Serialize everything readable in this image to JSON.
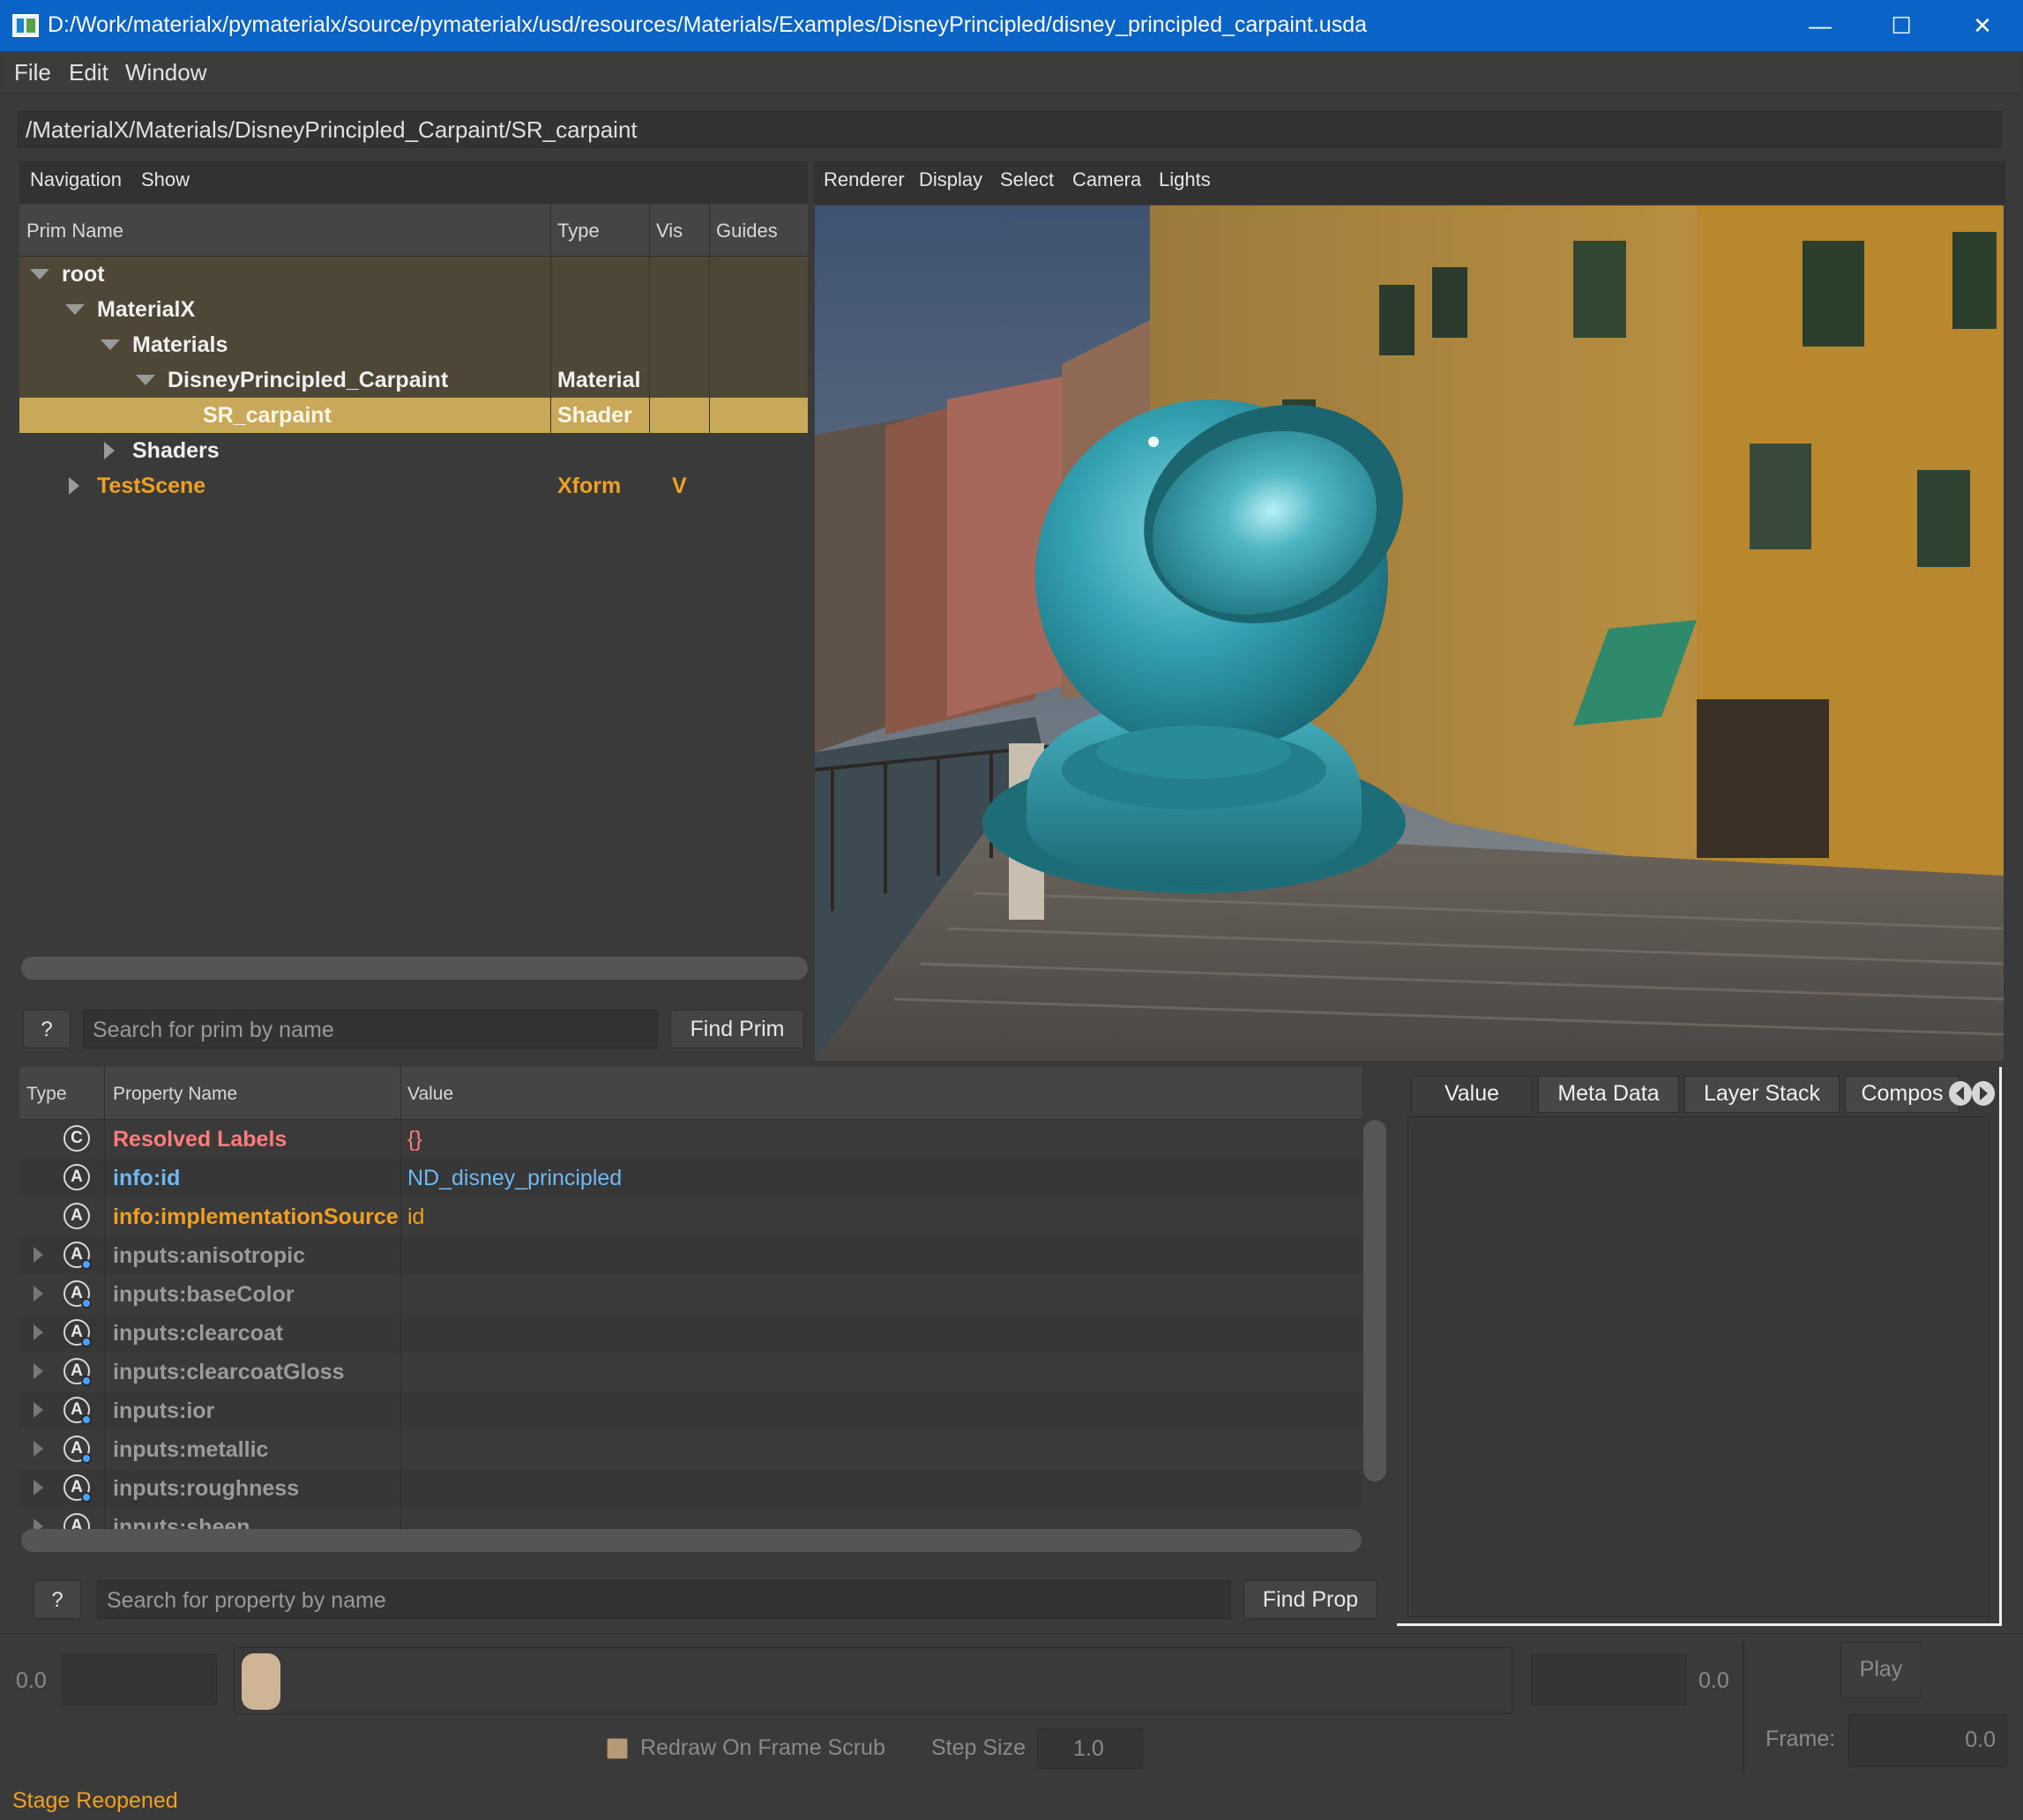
{
  "window": {
    "title": "D:/Work/materialx/pymaterialx/source/pymaterialx/usd/resources/Materials/Examples/DisneyPrincipled/disney_principled_carpaint.usda",
    "minimize": "—",
    "maximize": "☐",
    "close": "✕"
  },
  "menubar": {
    "items": [
      "File",
      "Edit",
      "Window"
    ]
  },
  "path": "/MaterialX/Materials/DisneyPrincipled_Carpaint/SR_carpaint",
  "prim_browser": {
    "menu": [
      "Navigation",
      "Show"
    ],
    "columns": [
      "Prim Name",
      "Type",
      "Vis",
      "Guides"
    ],
    "rows": [
      {
        "name": "root",
        "type": "",
        "vis": "",
        "depth": 0,
        "expand": "open"
      },
      {
        "name": "MaterialX",
        "type": "",
        "vis": "",
        "depth": 1,
        "expand": "open"
      },
      {
        "name": "Materials",
        "type": "",
        "vis": "",
        "depth": 2,
        "expand": "open"
      },
      {
        "name": "DisneyPrincipled_Carpaint",
        "type": "Material",
        "vis": "",
        "depth": 3,
        "expand": "open"
      },
      {
        "name": "SR_carpaint",
        "type": "Shader",
        "vis": "",
        "depth": 4,
        "expand": "none",
        "selected": true
      },
      {
        "name": "Shaders",
        "type": "",
        "vis": "",
        "depth": 2,
        "expand": "closed"
      },
      {
        "name": "TestScene",
        "type": "Xform",
        "vis": "V",
        "depth": 1,
        "expand": "closed",
        "orange": true
      }
    ],
    "help": "?",
    "search_placeholder": "Search for prim by name",
    "find_button": "Find Prim"
  },
  "viewport": {
    "menu": [
      "Renderer",
      "Display",
      "Select",
      "Camera",
      "Lights"
    ]
  },
  "properties": {
    "columns": [
      "Type",
      "Property Name",
      "Value"
    ],
    "rows": [
      {
        "icon": "C",
        "name": "Resolved Labels",
        "value": "{}",
        "color": "#ff7a7a",
        "value_color": "#ff7a7a",
        "expandable": false,
        "connected": false
      },
      {
        "icon": "A",
        "name": "info:id",
        "value": "ND_disney_principled",
        "color": "#6fb8f0",
        "value_color": "#6fb8f0",
        "expandable": false,
        "connected": false
      },
      {
        "icon": "A",
        "name": "info:implementationSource",
        "value": "id",
        "color": "#f0a020",
        "value_color": "#f0a020",
        "expandable": false,
        "connected": false
      },
      {
        "icon": "A",
        "name": "inputs:anisotropic",
        "value": "",
        "expandable": true,
        "connected": true
      },
      {
        "icon": "A",
        "name": "inputs:baseColor",
        "value": "",
        "expandable": true,
        "connected": true
      },
      {
        "icon": "A",
        "name": "inputs:clearcoat",
        "value": "",
        "expandable": true,
        "connected": true
      },
      {
        "icon": "A",
        "name": "inputs:clearcoatGloss",
        "value": "",
        "expandable": true,
        "connected": true
      },
      {
        "icon": "A",
        "name": "inputs:ior",
        "value": "",
        "expandable": true,
        "connected": true
      },
      {
        "icon": "A",
        "name": "inputs:metallic",
        "value": "",
        "expandable": true,
        "connected": true
      },
      {
        "icon": "A",
        "name": "inputs:roughness",
        "value": "",
        "expandable": true,
        "connected": true
      },
      {
        "icon": "A",
        "name": "inputs:sheen",
        "value": "",
        "expandable": true,
        "connected": true
      }
    ],
    "help": "?",
    "search_placeholder": "Search for property by name",
    "find_button": "Find Prop"
  },
  "inspector": {
    "tabs": [
      "Value",
      "Meta Data",
      "Layer Stack",
      "Compos"
    ]
  },
  "timeline": {
    "start_value": "0.0",
    "end_value": "0.0",
    "play": "Play",
    "frame_label": "Frame:",
    "frame_value": "0.0",
    "redraw_label": "Redraw On Frame Scrub",
    "step_label": "Step Size",
    "step_value": "1.0"
  },
  "status": "Stage Reopened",
  "colors": {
    "title_bar": "#0a64c8",
    "selection": "#caa85a",
    "accent_orange": "#f0a020",
    "material_teal": "#2e97a8"
  }
}
